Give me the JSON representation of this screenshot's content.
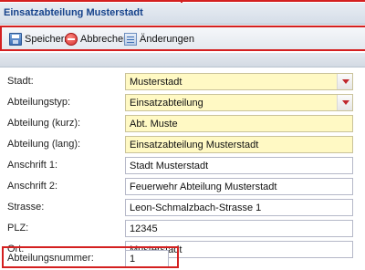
{
  "window": {
    "title": "Einsatzabteilung Musterstadt"
  },
  "toolbar": {
    "save_label": "Speichern",
    "cancel_label": "Abbrechen",
    "changes_label": "Änderungen"
  },
  "form": {
    "stadt": {
      "label": "Stadt:",
      "value": "Musterstadt"
    },
    "abteilungstyp": {
      "label": "Abteilungstyp:",
      "value": "Einsatzabteilung"
    },
    "abteilung_kurz": {
      "label": "Abteilung (kurz):",
      "value": "Abt. Muste"
    },
    "abteilung_lang": {
      "label": "Abteilung (lang):",
      "value": "Einsatzabteilung Musterstadt"
    },
    "anschrift1": {
      "label": "Anschrift 1:",
      "value": "Stadt Musterstadt"
    },
    "anschrift2": {
      "label": "Anschrift 2:",
      "value": "Feuerwehr Abteilung Musterstadt"
    },
    "strasse": {
      "label": "Strasse:",
      "value": "Leon-Schmalzbach-Strasse 1"
    },
    "plz": {
      "label": "PLZ:",
      "value": "12345"
    },
    "ort": {
      "label": "Ort:",
      "value": "Musterstadt"
    },
    "abteilungsnummer": {
      "label": "Abteilungsnummer:",
      "value": "1"
    }
  },
  "icons": {
    "save": "save-icon",
    "cancel": "cancel-icon",
    "changes": "changes-icon",
    "dropdown": "chevron-down-icon"
  },
  "colors": {
    "required_field": "#fff9c4",
    "highlight": "#d42020",
    "title_text": "#15428b"
  }
}
